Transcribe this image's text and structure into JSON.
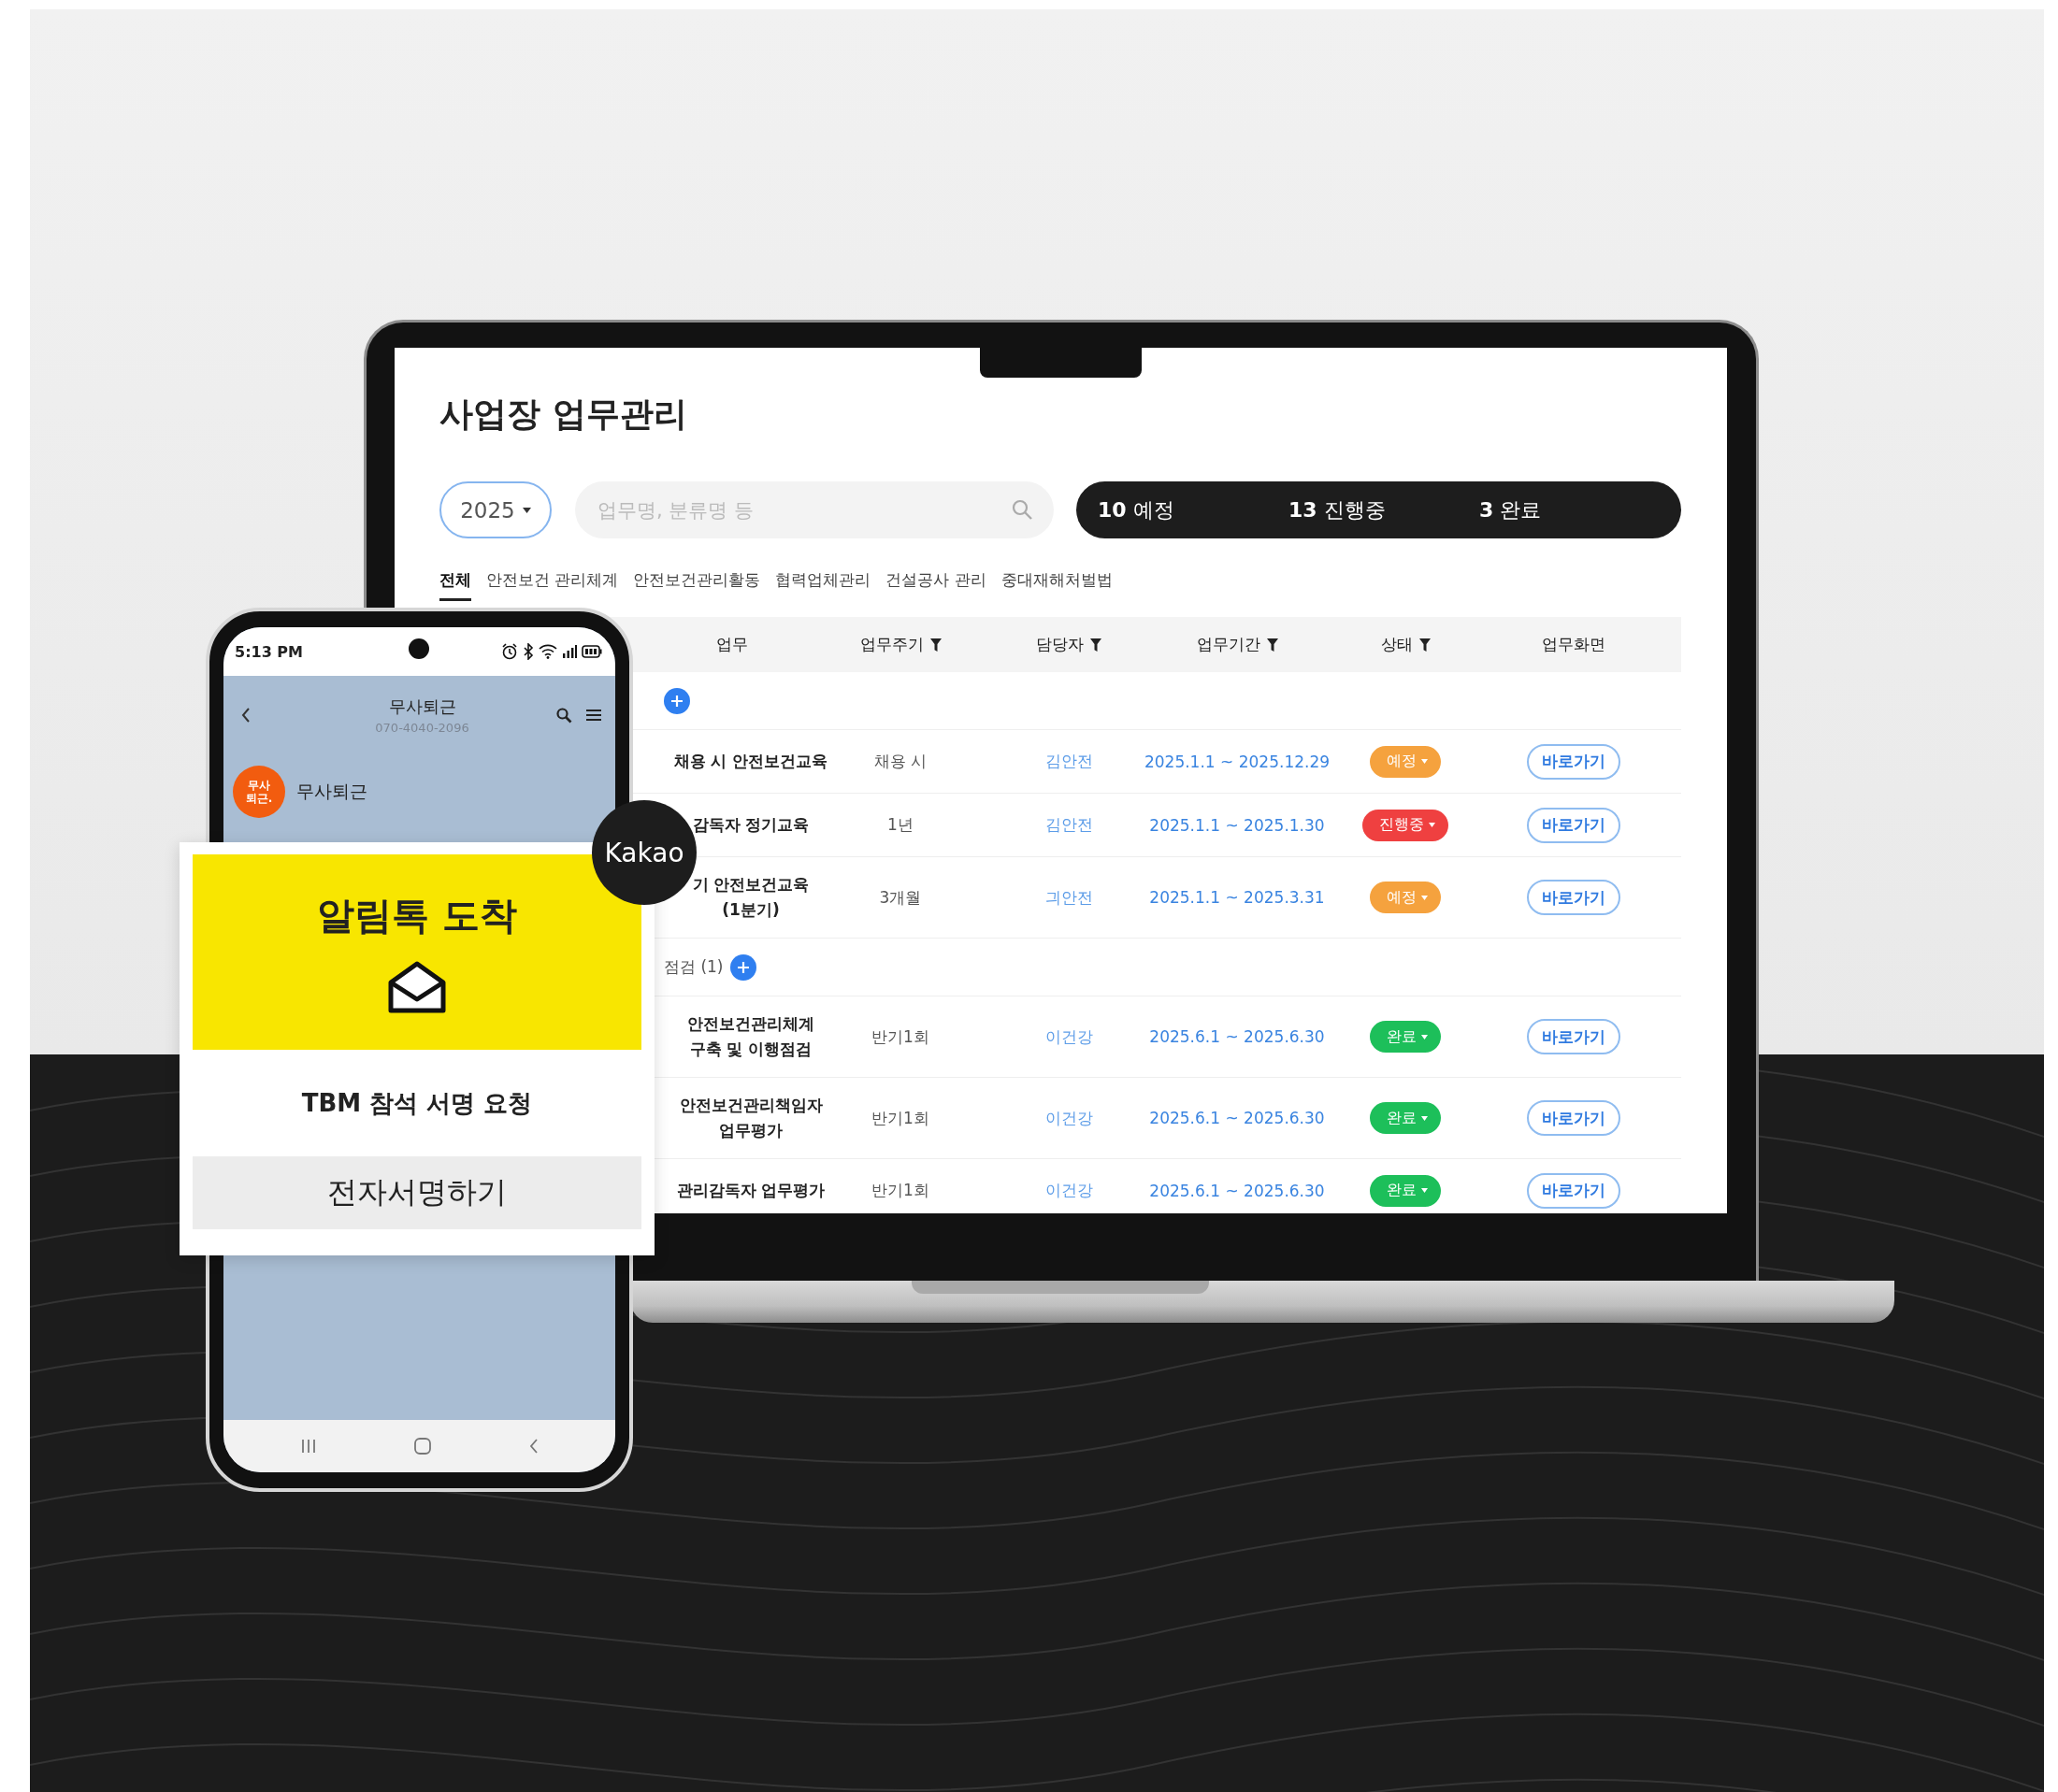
{
  "laptop": {
    "title": "사업장 업무관리",
    "year": "2025",
    "search": {
      "placeholder": "업무명, 분류명 등"
    },
    "summary": [
      "**10** 예정",
      "**13** 진행중",
      "**3** 완료"
    ],
    "tabs": [
      {
        "label": "전체",
        "selected": true
      },
      {
        "label": "안전보건 관리체계",
        "selected": false
      },
      {
        "label": "안전보건관리활동",
        "selected": false
      },
      {
        "label": "협력업체관리",
        "selected": false
      },
      {
        "label": "건설공사 관리",
        "selected": false
      },
      {
        "label": "중대재해처벌법",
        "selected": false
      }
    ],
    "table": {
      "columns": [
        {
          "label": "업무",
          "filter": false
        },
        {
          "label": "업무주기",
          "filter": true
        },
        {
          "label": "담당자",
          "filter": true
        },
        {
          "label": "업무기간",
          "filter": true
        },
        {
          "label": "상태",
          "filter": true
        },
        {
          "label": "업무화면",
          "filter": false
        }
      ],
      "rows": [
        {
          "kind": "group"
        },
        {
          "kind": "task",
          "task": "채용 시 안전보건교육",
          "cycle": "채용 시",
          "owner": "김안전",
          "period": "2025.1.1 ~ 2025.12.29",
          "status": {
            "label": "예정",
            "color": "#f5a23e"
          },
          "action": "바로가기"
        },
        {
          "kind": "task",
          "task": "감독자 정기교육",
          "cycle": "1년",
          "owner": "김안전",
          "period": "2025.1.1 ~ 2025.1.30",
          "status": {
            "label": "진행중",
            "color": "#ef4040"
          },
          "action": "바로가기"
        },
        {
          "kind": "task",
          "task": "기 안전보건교육\n(1분기)",
          "cycle": "3개월",
          "owner": "긔안전",
          "period": "2025.1.1 ~ 2025.3.31",
          "status": {
            "label": "예정",
            "color": "#f5a23e"
          },
          "action": "바로가기"
        },
        {
          "kind": "group",
          "label": "점검 (1)"
        },
        {
          "kind": "task",
          "task": "안전보건관리체계\n구축 및 이행점검",
          "cycle": "반기1회",
          "owner": "이건강",
          "period": "2025.6.1 ~ 2025.6.30",
          "status": {
            "label": "완료",
            "color": "#1dbf5a"
          },
          "action": "바로가기"
        },
        {
          "kind": "task",
          "task": "안전보건관리책임자\n업무평가",
          "cycle": "반기1회",
          "owner": "이건강",
          "period": "2025.6.1 ~ 2025.6.30",
          "status": {
            "label": "완료",
            "color": "#1dbf5a"
          },
          "action": "바로가기"
        },
        {
          "kind": "task",
          "task": "관리감독자 업무평가",
          "cycle": "반기1회",
          "owner": "이건강",
          "period": "2025.6.1 ~ 2025.6.30",
          "status": {
            "label": "완료",
            "color": "#1dbf5a"
          },
          "action": "바로가기"
        }
      ]
    }
  },
  "phone": {
    "time": "5:13 PM",
    "chat_title": "무사퇴근",
    "chat_number": "070-4040-2096",
    "avatar": "무사\n퇴근.",
    "sender": "무사퇴근"
  },
  "alert": {
    "badge": "Kakao",
    "title": "알림톡 도착",
    "message": "TBM 참석 서명 요청",
    "button": "전자서명하기"
  }
}
